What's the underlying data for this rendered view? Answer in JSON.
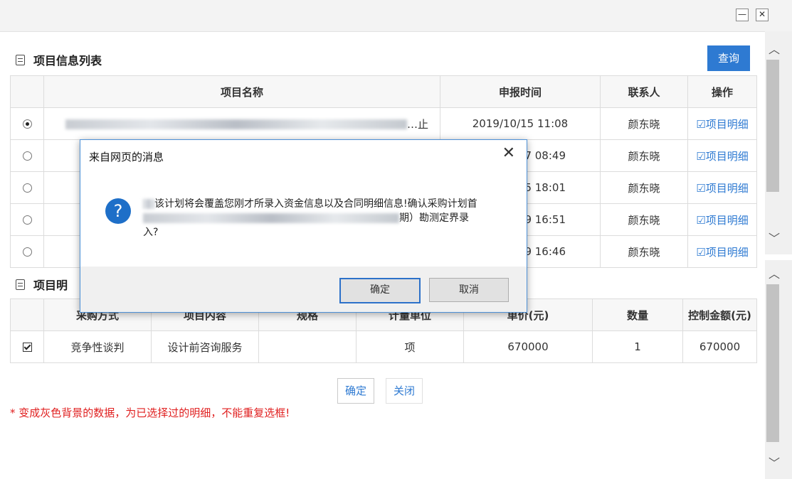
{
  "window": {
    "minimize_label": "—",
    "close_label": "✕"
  },
  "section1": {
    "title": "项目信息列表",
    "query_label": "查询"
  },
  "project_table": {
    "headers": [
      "",
      "项目名称",
      "申报时间",
      "联系人",
      "操作"
    ],
    "rows": [
      {
        "selected": true,
        "name_tail": "…止",
        "time": "2019/10/15 11:08",
        "contact": "颜东晓",
        "action": "项目明细"
      },
      {
        "selected": false,
        "name_tail": "",
        "time": "7 08:49",
        "contact": "颜东晓",
        "action": "项目明细"
      },
      {
        "selected": false,
        "name_tail": "",
        "time": "5 18:01",
        "contact": "颜东晓",
        "action": "项目明细"
      },
      {
        "selected": false,
        "name_tail": "",
        "time": "9 16:51",
        "contact": "颜东晓",
        "action": "项目明细"
      },
      {
        "selected": false,
        "name_tail": "",
        "time": "9 16:46",
        "contact": "颜东晓",
        "action": "项目明细"
      }
    ]
  },
  "section2": {
    "title": "项目明"
  },
  "detail_table": {
    "headers": [
      "",
      "采购方式",
      "项目内容",
      "规格",
      "计量单位",
      "单价(元)",
      "数量",
      "控制金额(元)"
    ],
    "rows": [
      {
        "checked": true,
        "method": "竞争性谈判",
        "content": "设计前咨询服务",
        "spec": "",
        "unit": "项",
        "price": "670000",
        "qty": "1",
        "amount": "670000"
      }
    ]
  },
  "footer": {
    "confirm_label": "确定",
    "close_label": "关闭",
    "note": "* 变成灰色背景的数据，为已选择过的明细，不能重复选框!"
  },
  "dialog": {
    "title": "来自网页的消息",
    "close_label": "✕",
    "icon": "question-icon",
    "message_line1": "该计划将会覆盖您刚才所录入资金信息以及合同明细信息!确认采购计划首",
    "message_line2": "期）勘测定界录",
    "message_line3": "入?",
    "ok_label": "确定",
    "cancel_label": "取消"
  },
  "colors": {
    "accent": "#2e7ad2",
    "warning": "#e02020"
  }
}
